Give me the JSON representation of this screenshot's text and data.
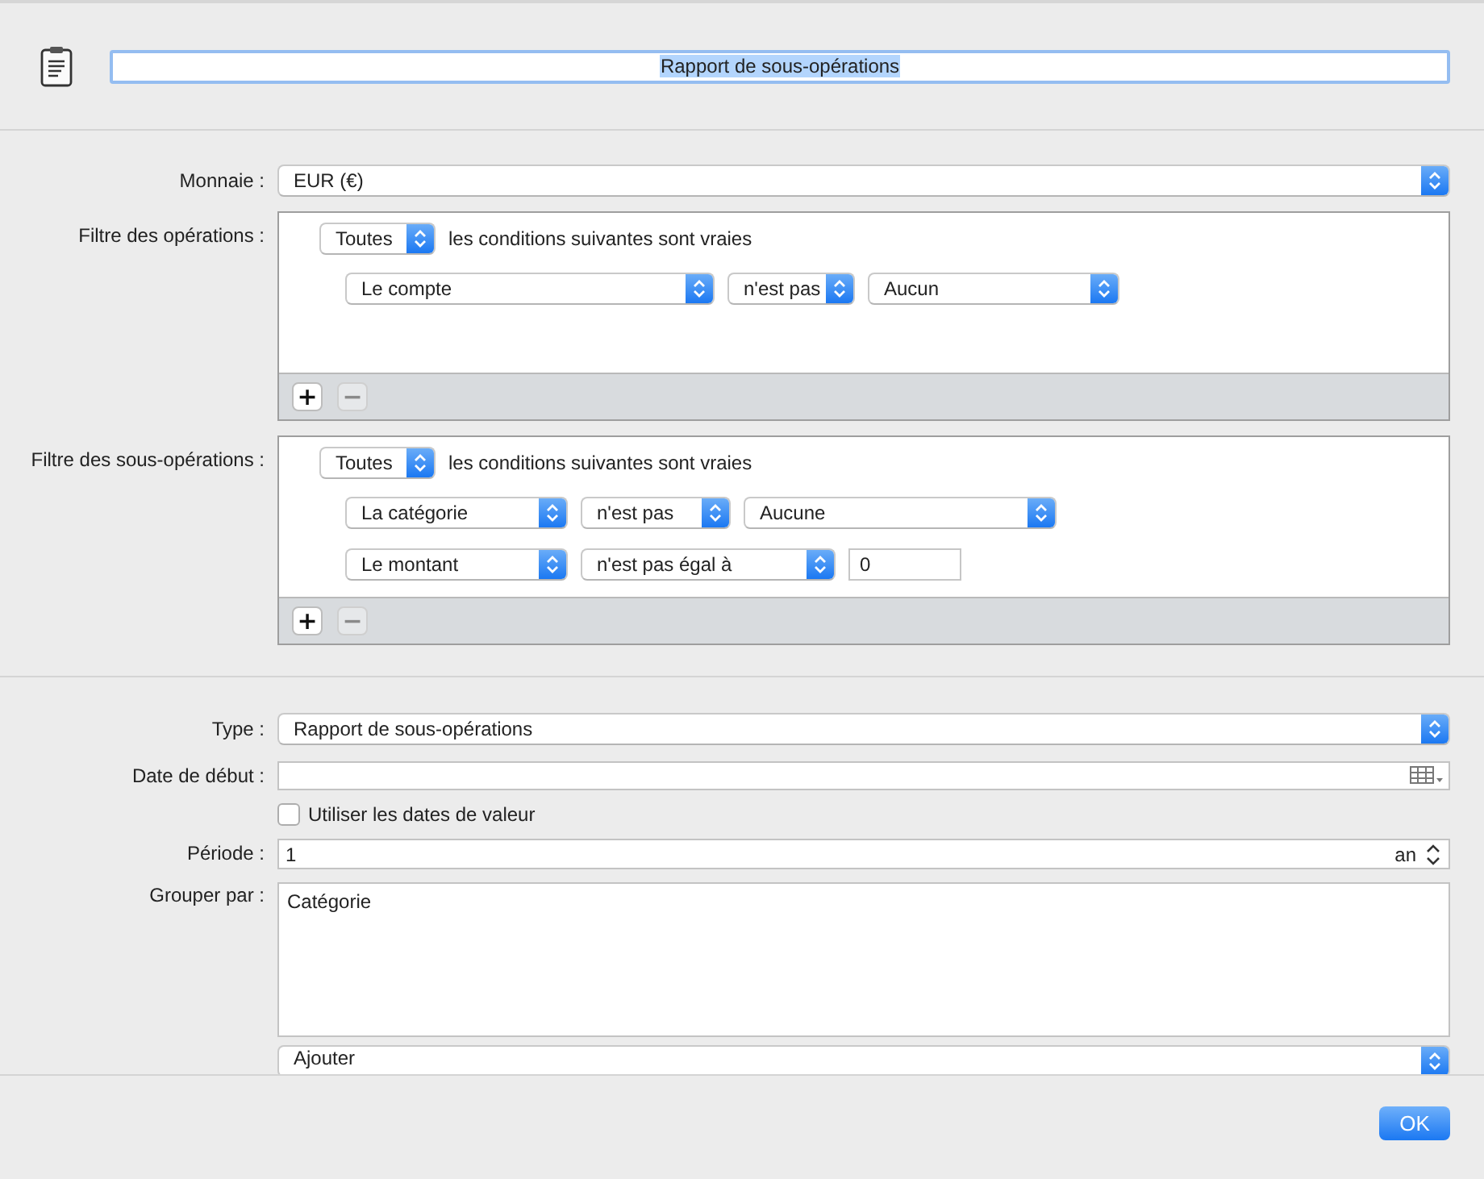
{
  "title": {
    "value": "Rapport de sous-opérations",
    "text_selected": true
  },
  "currency": {
    "label": "Monnaie :",
    "value": "EUR (€)"
  },
  "filters": [
    {
      "label": "Filtre des opérations :",
      "match": "Toutes",
      "match_text": "les conditions suivantes sont vraies",
      "conditions": [
        [
          {
            "kind": "popup",
            "value": "Le compte"
          },
          {
            "kind": "popup",
            "value": "n'est pas"
          },
          {
            "kind": "popup",
            "value": "Aucun"
          }
        ]
      ],
      "buttons": [
        {
          "symbol": "+",
          "disabled": false
        },
        {
          "symbol": "−",
          "disabled": true
        }
      ]
    },
    {
      "label": "Filtre des sous-opérations :",
      "match": "Toutes",
      "match_text": "les conditions suivantes sont vraies",
      "conditions": [
        [
          {
            "kind": "popup",
            "value": "La catégorie"
          },
          {
            "kind": "popup",
            "value": "n'est pas"
          },
          {
            "kind": "popup",
            "value": "Aucune"
          }
        ],
        [
          {
            "kind": "popup",
            "value": "Le montant"
          },
          {
            "kind": "popup",
            "value": "n'est pas égal à"
          },
          {
            "kind": "field",
            "value": "0"
          }
        ]
      ],
      "buttons": [
        {
          "symbol": "+",
          "disabled": false
        },
        {
          "symbol": "−",
          "disabled": true
        }
      ]
    }
  ],
  "type": {
    "label": "Type :",
    "value": "Rapport de sous-opérations"
  },
  "start_date": {
    "label": "Date de début :"
  },
  "value_dates": {
    "label": "Utiliser les dates de valeur",
    "checked": false
  },
  "period": {
    "label": "Période :",
    "value": "1",
    "unit": "an"
  },
  "group_by": {
    "label": "Grouper par :",
    "items": [
      "Catégorie"
    ]
  },
  "add_popup": {
    "value": "Ajouter"
  },
  "ok_button": "OK"
}
